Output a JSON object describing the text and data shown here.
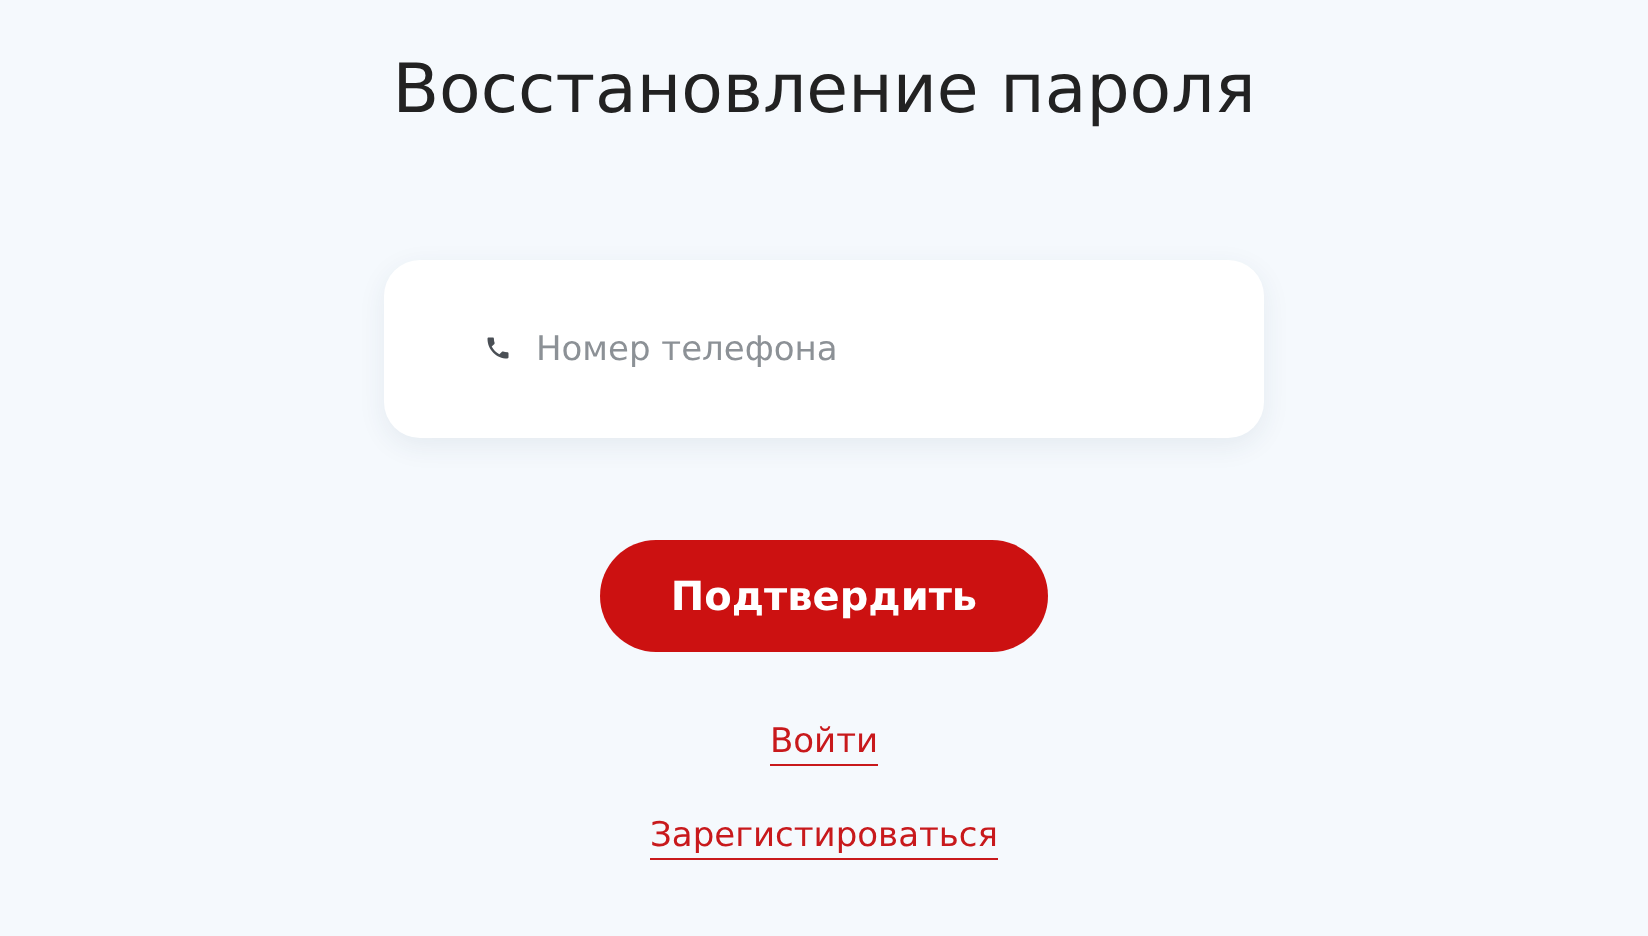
{
  "title": "Восстановление пароля",
  "phone_field": {
    "placeholder": "Номер телефона"
  },
  "submit_button": "Подтвердить",
  "links": [
    "Войти",
    "Зарегистироваться"
  ]
}
